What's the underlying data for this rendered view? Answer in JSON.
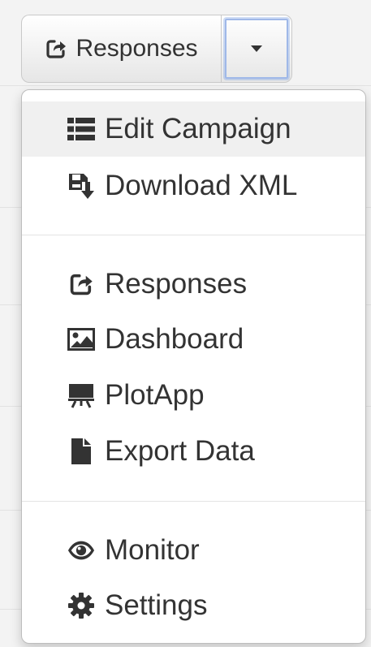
{
  "toolbar": {
    "main_button_label": "Responses",
    "main_button_icon": "share-square-icon",
    "caret_icon": "caret-down-icon"
  },
  "menu": {
    "items": [
      {
        "label": "Edit Campaign",
        "icon": "list-icon"
      },
      {
        "label": "Download XML",
        "icon": "save-download-icon"
      },
      {
        "label": "Responses",
        "icon": "share-square-icon"
      },
      {
        "label": "Dashboard",
        "icon": "picture-icon"
      },
      {
        "label": "PlotApp",
        "icon": "presentation-icon"
      },
      {
        "label": "Export Data",
        "icon": "file-icon"
      },
      {
        "label": "Monitor",
        "icon": "eye-icon"
      },
      {
        "label": "Settings",
        "icon": "gear-icon"
      }
    ]
  },
  "colors": {
    "text": "#333333",
    "active_item_bg": "#f0f0f0",
    "focus_ring": "#9fb8e8"
  }
}
